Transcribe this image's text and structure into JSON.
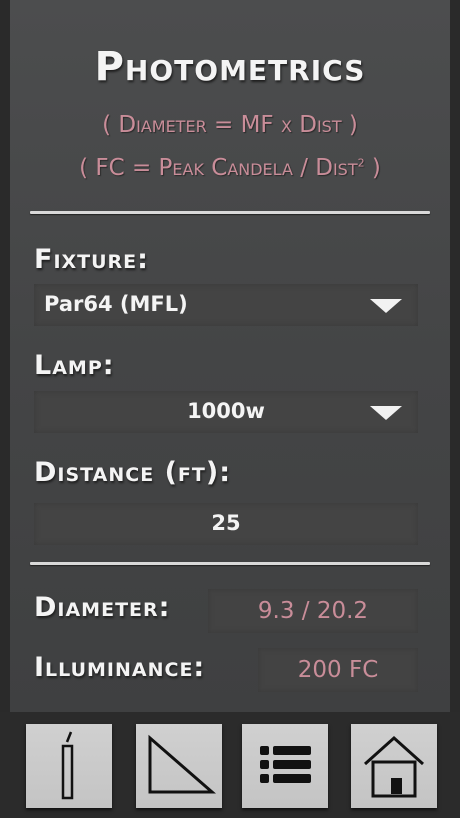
{
  "header": {
    "title": "Photometrics",
    "formula_diameter": "( Diameter = MF x Dist )",
    "formula_fc_prefix": "( FC = Peak Candela / Dist",
    "formula_fc_sup": "2",
    "formula_fc_suffix": " )"
  },
  "inputs": {
    "fixture_label": "Fixture:",
    "fixture_value": "Par64 (MFL)",
    "lamp_label": "Lamp:",
    "lamp_value": "1000w",
    "distance_label": "Distance (ft):",
    "distance_value": "25"
  },
  "results": {
    "diameter_label": "Diameter:",
    "diameter_value": "9.3 / 20.2",
    "illuminance_label": "Illuminance:",
    "illuminance_value": "200 FC"
  },
  "toolbar": {
    "buttons": [
      "pencil-icon",
      "triangle-icon",
      "list-icon",
      "home-icon"
    ]
  },
  "colors": {
    "accent": "#c98d99",
    "panel": "#474849",
    "text": "#f4f4f4"
  }
}
